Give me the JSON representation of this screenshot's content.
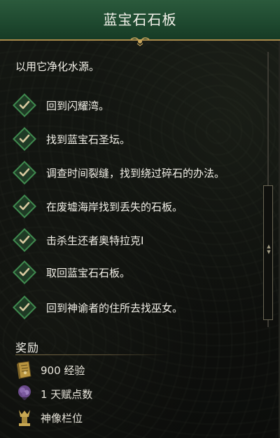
{
  "title": "蓝宝石石板",
  "description": "以用它净化水源。",
  "objectives": [
    {
      "text": "回到闪耀湾。",
      "completed": true
    },
    {
      "text": "找到蓝宝石圣坛。",
      "completed": true
    },
    {
      "text": "调查时间裂缝，找到绕过碎石的办法。",
      "completed": true
    },
    {
      "text": "在废墟海岸找到丢失的石板。",
      "completed": true
    },
    {
      "text": "击杀生还者奥特拉克I",
      "completed": true
    },
    {
      "text": "取回蓝宝石石板。",
      "completed": true
    },
    {
      "text": "回到神谕者的住所去找巫女。",
      "completed": true
    }
  ],
  "rewards": {
    "heading": "奖励",
    "items": [
      {
        "text": "900 经验",
        "icon": "experience-book-icon"
      },
      {
        "text": "1 天赋点数",
        "icon": "talent-point-icon"
      },
      {
        "text": "神像栏位",
        "icon": "idol-slot-icon"
      }
    ]
  },
  "colors": {
    "title_bar": "#1f4a30",
    "gold_accent": "#a98a4a",
    "check_green": "#2f6a3c",
    "text": "#f2f0e8",
    "background": "#0f110e"
  }
}
